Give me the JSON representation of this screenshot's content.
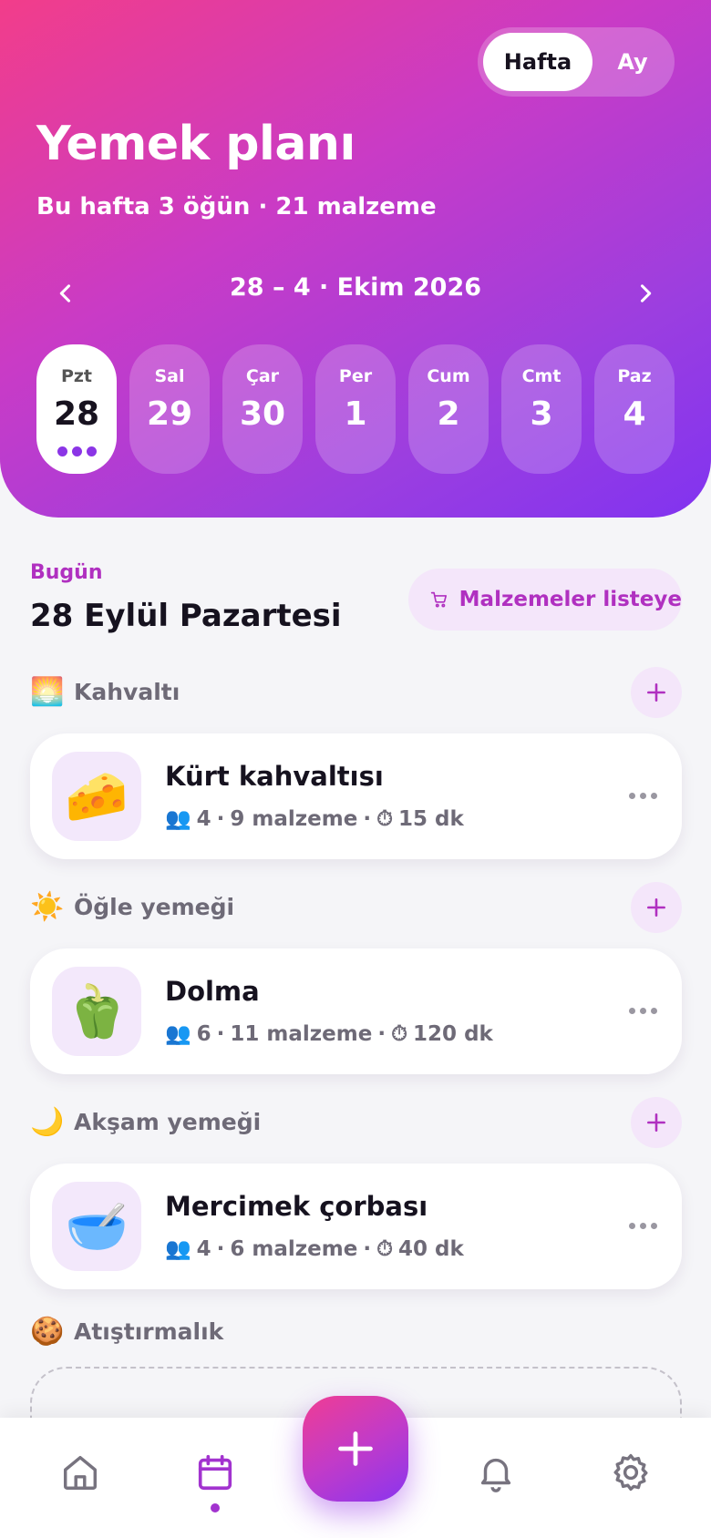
{
  "view_toggle": {
    "week": "Hafta",
    "month": "Ay",
    "selected": "Hafta"
  },
  "header": {
    "title": "Yemek planı",
    "subtitle": "Bu hafta 3 öğün · 21 malzeme",
    "week_range": "28 – 4 · Ekim 2026"
  },
  "days": [
    {
      "name": "Pzt",
      "num": "28",
      "active": true,
      "meal_dots": 3
    },
    {
      "name": "Sal",
      "num": "29",
      "active": false
    },
    {
      "name": "Çar",
      "num": "30",
      "active": false
    },
    {
      "name": "Per",
      "num": "1",
      "active": false
    },
    {
      "name": "Cum",
      "num": "2",
      "active": false
    },
    {
      "name": "Cmt",
      "num": "3",
      "active": false
    },
    {
      "name": "Paz",
      "num": "4",
      "active": false
    }
  ],
  "today": {
    "label": "Bugün",
    "date": "28 Eylül Pazartesi",
    "shopping_button": "Malzemeler listeye"
  },
  "sections": [
    {
      "emoji": "🌅",
      "title": "Kahvaltı",
      "meal": {
        "emoji": "🧀",
        "name": "Kürt kahvaltısı",
        "servings_icon": "👥",
        "servings": "4",
        "ingredients": "9 malzeme",
        "time_icon": "⏱",
        "time": "15 dk"
      }
    },
    {
      "emoji": "☀️",
      "title": "Öğle yemeği",
      "meal": {
        "emoji": "🫑",
        "name": "Dolma",
        "servings_icon": "👥",
        "servings": "6",
        "ingredients": "11 malzeme",
        "time_icon": "⏱",
        "time": "120 dk"
      }
    },
    {
      "emoji": "🌙",
      "title": "Akşam yemeği",
      "meal": {
        "emoji": "🥣",
        "name": "Mercimek çorbası",
        "servings_icon": "👥",
        "servings": "4",
        "ingredients": "6 malzeme",
        "time_icon": "⏱",
        "time": "40 dk"
      }
    },
    {
      "emoji": "🍪",
      "title": "Atıştırmalık"
    }
  ],
  "meta_separator": "·",
  "bottom_nav": {
    "items": [
      "home-icon",
      "calendar-icon",
      "bell-icon",
      "gear-icon"
    ],
    "active": "calendar-icon"
  },
  "colors": {
    "accent": "#b030c0",
    "accent_bg": "#f4e6fa",
    "gradient_start": "#f23d8a",
    "gradient_end": "#8133f0"
  }
}
